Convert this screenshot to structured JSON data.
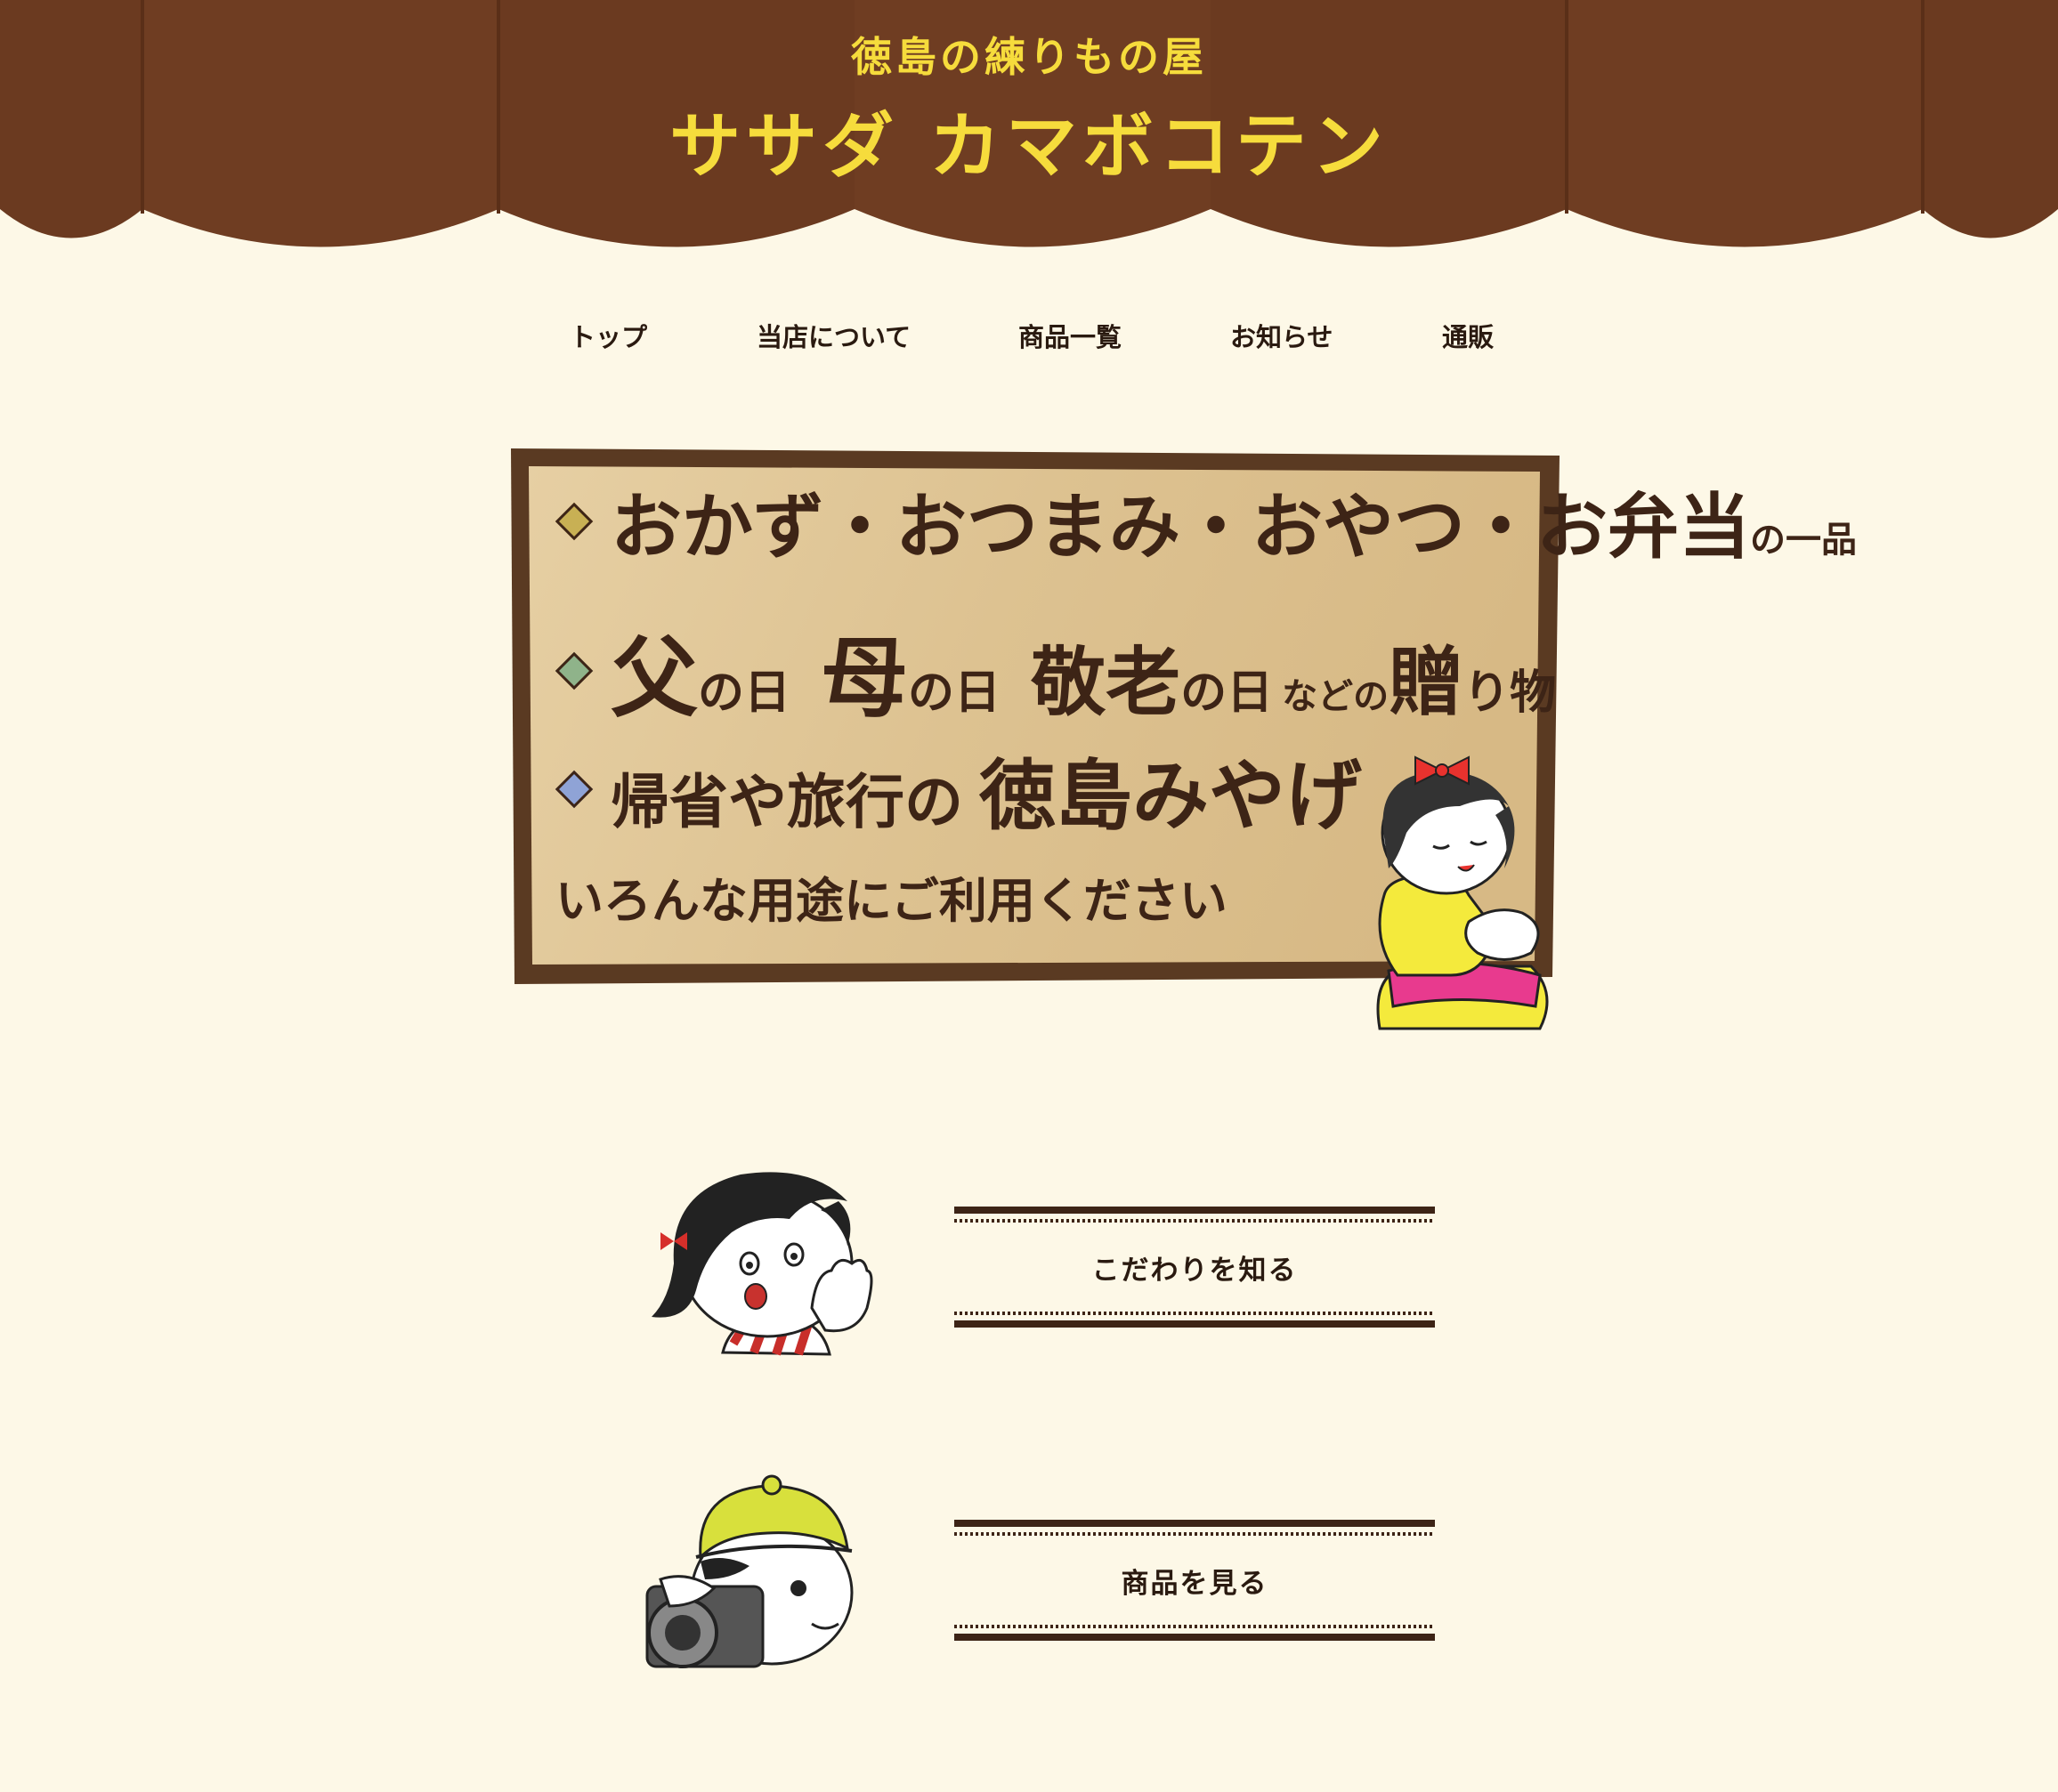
{
  "header": {
    "subtitle": "徳島の練りもの屋",
    "title": "ササダ カマボコテン",
    "colors": {
      "awning": "#6b3a20",
      "text": "#f6dc3c",
      "background": "#fdf8e7"
    }
  },
  "nav": {
    "items": [
      {
        "label": "トップ"
      },
      {
        "label": "当店について"
      },
      {
        "label": "商品一覧"
      },
      {
        "label": "お知らせ"
      },
      {
        "label": "通販"
      }
    ]
  },
  "sign": {
    "row1": {
      "text": "おかず・おつまみ・おやつ・お弁当",
      "suffix": "の一品",
      "diamond_color": "#c8b054"
    },
    "row2": {
      "w1": "父",
      "s1": "の日",
      "w2": "母",
      "s2": "の日",
      "w3": "敬老",
      "s3": "の日",
      "s4": "などの",
      "w4": "贈",
      "s5": "り物",
      "diamond_color": "#8fb38a"
    },
    "row3": {
      "text": "帰省や旅行の",
      "big": "徳島みやげ",
      "diamond_color": "#8fa3d6"
    },
    "row4": {
      "text": "いろんな用途にご利用ください"
    }
  },
  "links": [
    {
      "label": "こだわりを知る"
    },
    {
      "label": "商品を見る"
    }
  ]
}
